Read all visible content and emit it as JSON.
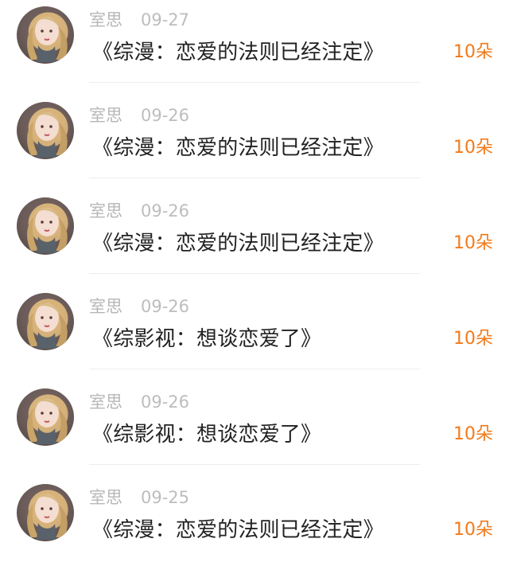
{
  "items": [
    {
      "user": "室思",
      "date": "09-27",
      "title": "《综漫：恋爱的法则已经注定》",
      "count": "10朵"
    },
    {
      "user": "室思",
      "date": "09-26",
      "title": "《综漫：恋爱的法则已经注定》",
      "count": "10朵"
    },
    {
      "user": "室思",
      "date": "09-26",
      "title": "《综漫：恋爱的法则已经注定》",
      "count": "10朵"
    },
    {
      "user": "室思",
      "date": "09-26",
      "title": "《综影视：想谈恋爱了》",
      "count": "10朵"
    },
    {
      "user": "室思",
      "date": "09-26",
      "title": "《综影视：想谈恋爱了》",
      "count": "10朵"
    },
    {
      "user": "室思",
      "date": "09-25",
      "title": "《综漫：恋爱的法则已经注定》",
      "count": "10朵"
    }
  ],
  "colors": {
    "username": "#b7b7b7",
    "date": "#bdbdbd",
    "title": "#222222",
    "count": "#f27a1a"
  },
  "icons": {
    "avatar": "avatar-icon"
  }
}
